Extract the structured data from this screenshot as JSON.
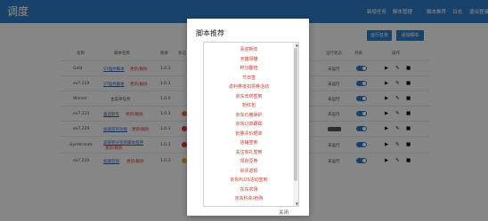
{
  "app": {
    "brand": "调度"
  },
  "navbar": {
    "links": [
      "新增任务",
      "脚本管理",
      "脚本推荐",
      "日志",
      "退出登录"
    ]
  },
  "toolbar": {
    "buttons": [
      "运行任务",
      "添加脚本"
    ]
  },
  "table": {
    "headers": [
      "名称",
      "脚本名称",
      "版本",
      "状态",
      "运行状态",
      "开关",
      "操作"
    ],
    "rows": [
      {
        "name": "Gold",
        "script": "ST插件脚本",
        "tag": "更新/删除",
        "ver": "1.0.3",
        "status": "未运行"
      },
      {
        "name": "ex7.229",
        "script": "ST插件脚本",
        "tag": "更新/删除",
        "ver": "1.0.3",
        "status": "未运行"
      },
      {
        "name": "Winner",
        "script": "主菜单任务",
        "tag": "",
        "ver": "1.0.0",
        "status": "未运行"
      },
      {
        "name": "ex7.233",
        "script": "喜迎新年",
        "tag": "更新/删除",
        "ver": "1.0.3",
        "status": "未运行"
      },
      {
        "name": "ex7.229",
        "script": "加速签到功能",
        "tag": "更新/删除",
        "ver": "1.0.3",
        "status": ""
      },
      {
        "name": "Gymbrands",
        "script": "双倍积分签到脚本程序",
        "tag": "更新/删除",
        "ver": "1.0.3",
        "status": "未运行"
      },
      {
        "name": "ex7.229",
        "script": "加速签到",
        "tag": "更新/删除",
        "ver": "1.0.3",
        "status": "未运行"
      }
    ]
  },
  "modal": {
    "title": "脚本推荐",
    "close_label": "关闭",
    "items": [
      "喜迎新年",
      "天猫领猫",
      "积分翻倍",
      "节日签",
      "返利券抵扣领券活动",
      "京东年终签到",
      "抢红包",
      "京东价格保护",
      "京东订单跟踪",
      "批量评价晒单",
      "店铺签到",
      "关注有礼签到",
      "领京豆券",
      "好评返现",
      "京东PLUS活动签到",
      "东东农场",
      "京东秒杀/抢购"
    ]
  },
  "colors": {
    "accent": "#2f79c4",
    "danger": "#c0392b"
  }
}
